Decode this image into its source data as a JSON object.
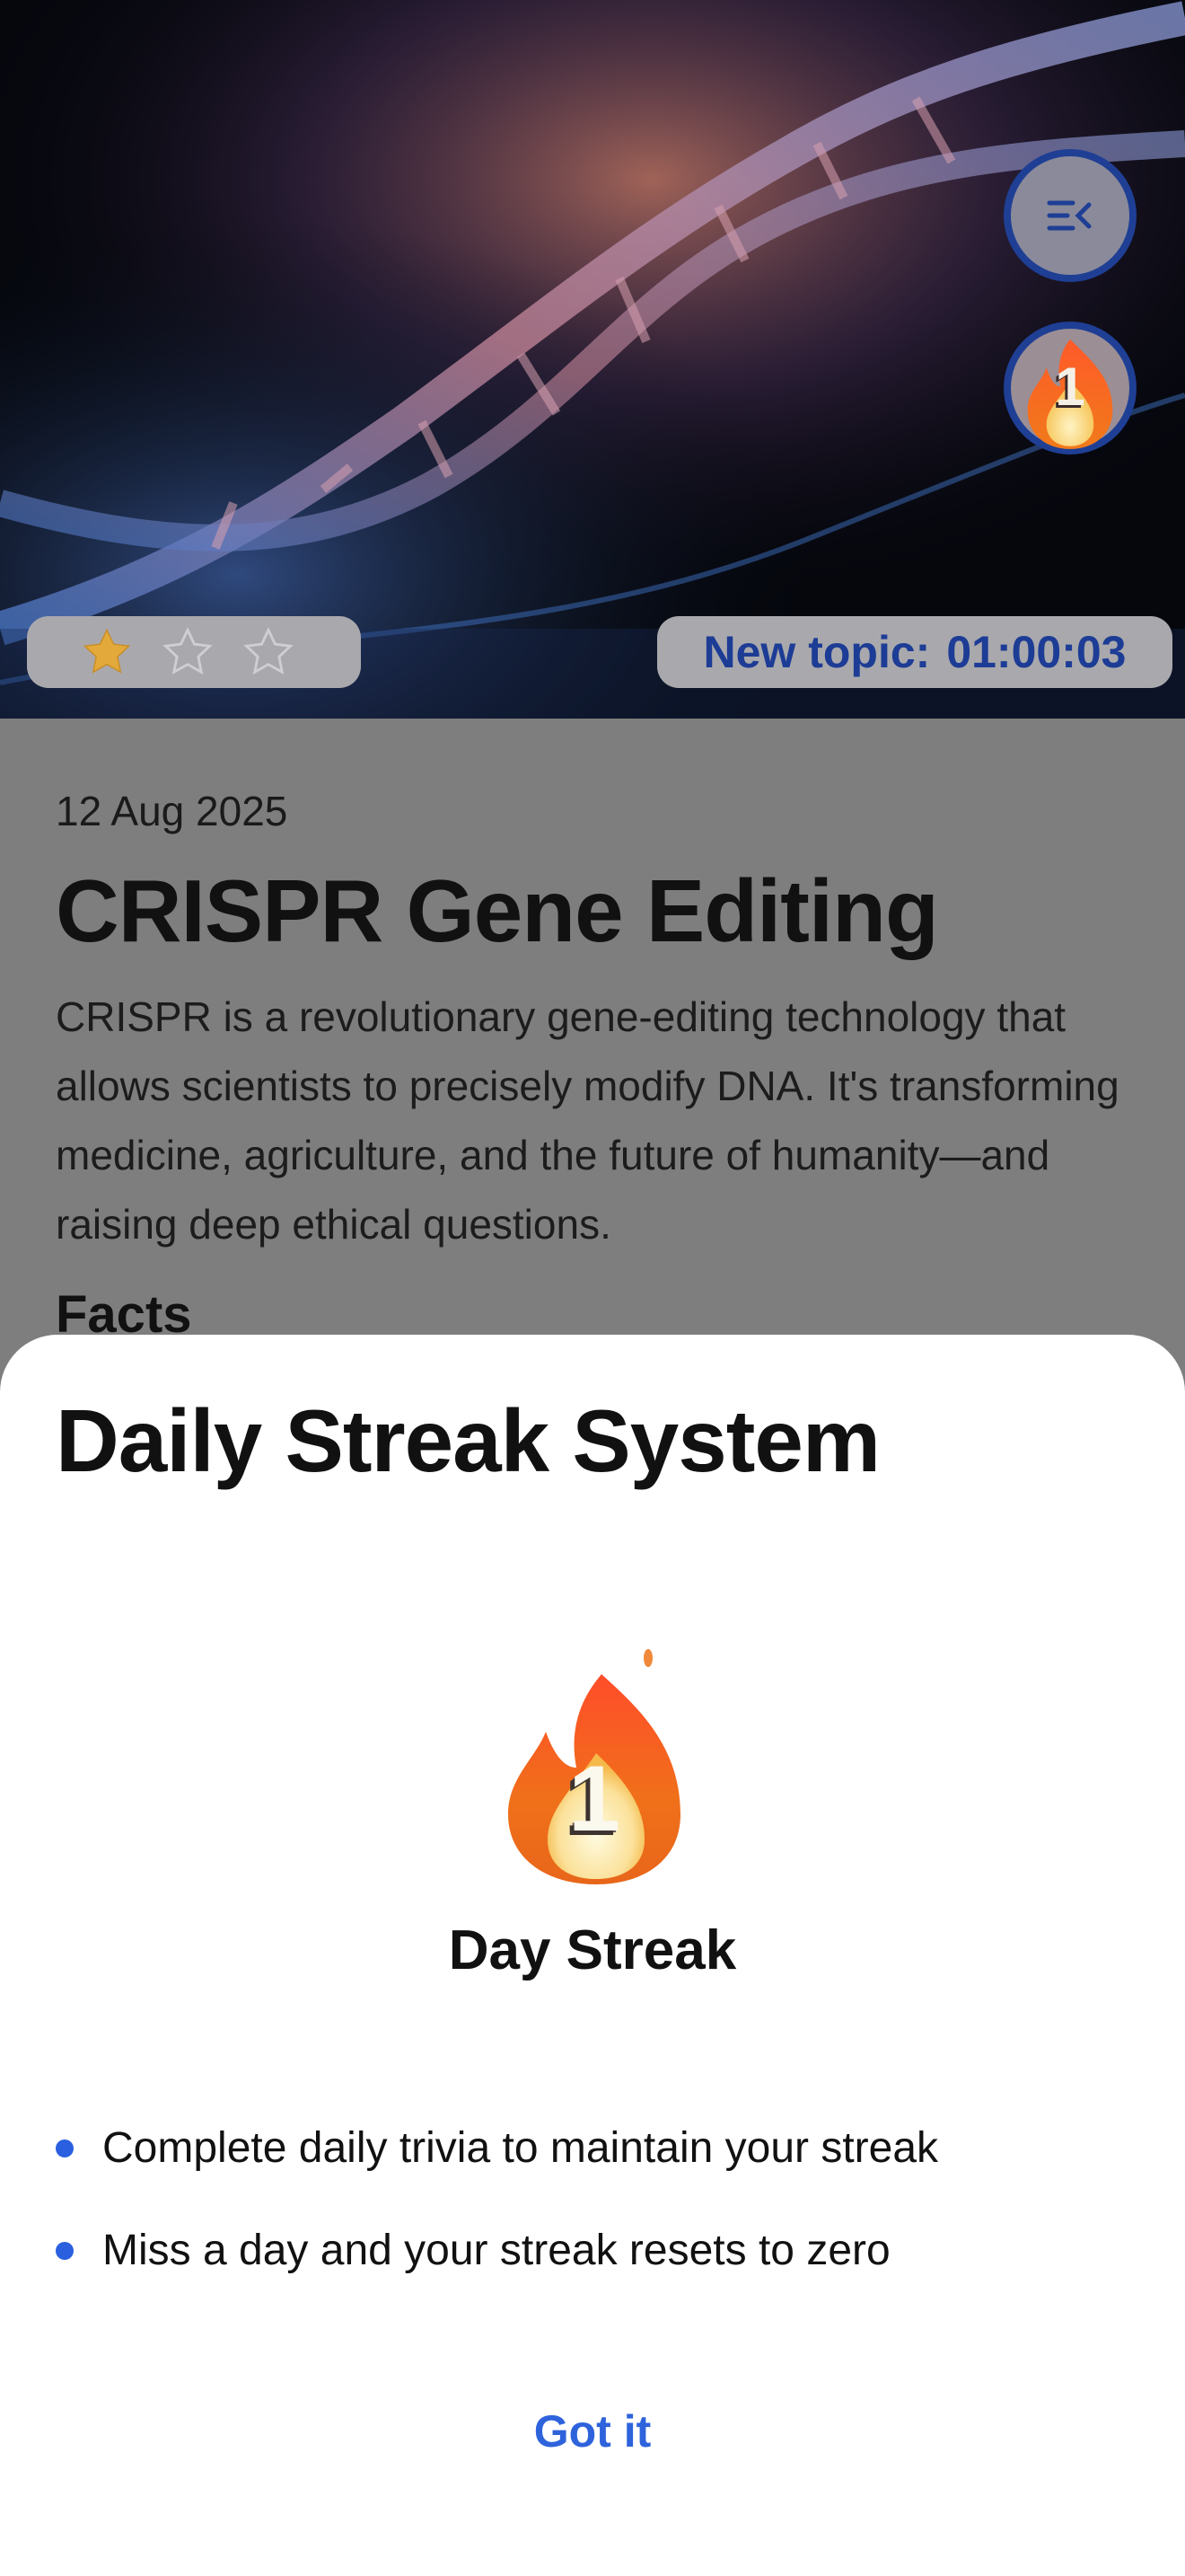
{
  "hero": {
    "rating": {
      "filled_stars": 1,
      "total_stars": 3,
      "icons": [
        "star-filled-icon",
        "star-outline-icon",
        "star-outline-icon"
      ]
    },
    "timer": {
      "label": "New topic:",
      "value": "01:00:03"
    },
    "menu_icon": "collapse-menu-icon",
    "streak_badge": {
      "icon": "flame-icon",
      "count": "1"
    }
  },
  "article": {
    "date": "12 Aug 2025",
    "title": "CRISPR Gene Editing",
    "description": "CRISPR is a revolutionary gene-editing technology that allows scientists to precisely modify DNA. It's transforming medicine, agriculture, and the future of humanity—and raising deep ethical questions.",
    "section_heading": "Facts"
  },
  "sheet": {
    "title": "Daily Streak System",
    "streak_count": "1",
    "streak_label": "Day Streak",
    "rules": [
      "Complete daily trivia to maintain your streak",
      "Miss a day and your streak resets to zero"
    ],
    "confirm_label": "Got it"
  },
  "colors": {
    "accent": "#2e63dc",
    "badge_border": "#1f3f95",
    "timer_text": "#1d3c95",
    "overlay_dim": "#7e7e7e"
  }
}
